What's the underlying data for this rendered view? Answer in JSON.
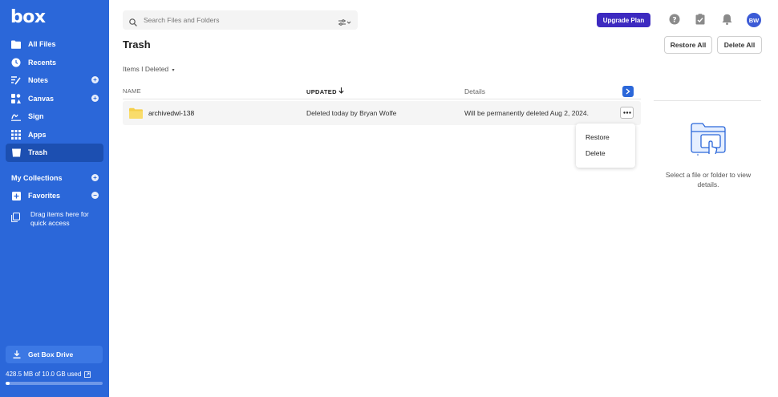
{
  "brand": {
    "logo_text": "box"
  },
  "sidebar": {
    "items": [
      {
        "label": "All Files",
        "icon": "folder-icon"
      },
      {
        "label": "Recents",
        "icon": "clock-icon"
      },
      {
        "label": "Notes",
        "icon": "notes-icon"
      },
      {
        "label": "Canvas",
        "icon": "canvas-icon"
      },
      {
        "label": "Sign",
        "icon": "sign-icon"
      },
      {
        "label": "Apps",
        "icon": "apps-grid-icon"
      },
      {
        "label": "Trash",
        "icon": "trash-icon",
        "active": true
      }
    ],
    "my_collections": "My Collections",
    "favorites": "Favorites",
    "drag_hint": "Drag items here for quick access",
    "get_drive": "Get Box Drive",
    "storage_used": "428.5 MB of 10.0 GB used",
    "storage_fraction": 0.043
  },
  "search": {
    "placeholder": "Search Files and Folders"
  },
  "top": {
    "upgrade": "Upgrade Plan",
    "avatar_initials": "BW"
  },
  "page": {
    "title": "Trash",
    "restore_all": "Restore All",
    "delete_all": "Delete All",
    "filter_label": "Items I Deleted"
  },
  "table": {
    "col_name": "NAME",
    "col_updated": "UPDATED",
    "col_details": "Details",
    "rows": [
      {
        "name": "archivedwl-138",
        "updated": "Deleted today by Bryan Wolfe",
        "details": "Will be permanently deleted Aug 2, 2024."
      }
    ]
  },
  "menu": {
    "restore": "Restore",
    "delete": "Delete"
  },
  "details_panel": {
    "empty_text": "Select a file or folder to view details."
  },
  "colors": {
    "sidebar": "#2b67d9",
    "upgrade": "#3d2ac0",
    "folder": "#f5cf4b"
  }
}
